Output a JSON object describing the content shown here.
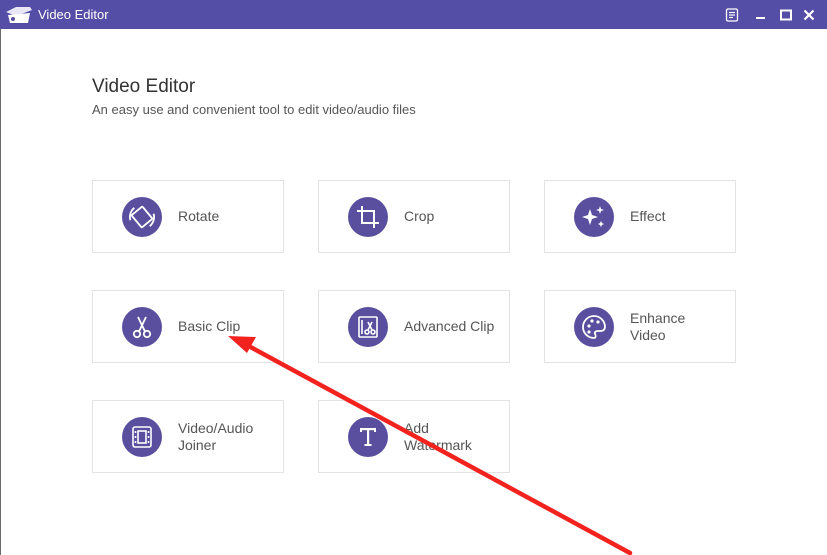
{
  "window": {
    "title": "Video Editor",
    "accent": "#554ea6"
  },
  "header": {
    "title": "Video Editor",
    "subtitle": "An easy use and convenient tool to edit video/audio files"
  },
  "tools": [
    {
      "label": "Rotate",
      "icon": "rotate-icon"
    },
    {
      "label": "Crop",
      "icon": "crop-icon"
    },
    {
      "label": "Effect",
      "icon": "sparkle-icon"
    },
    {
      "label": "Basic Clip",
      "icon": "scissors-icon"
    },
    {
      "label": "Advanced Clip",
      "icon": "film-scissors-icon"
    },
    {
      "label": "Enhance\nVideo",
      "icon": "palette-icon"
    },
    {
      "label": "Video/Audio\nJoiner",
      "icon": "film-joiner-icon"
    },
    {
      "label": "Add\nWatermark",
      "icon": "text-t-icon"
    }
  ],
  "icon_color": "#5a4f9e",
  "annotation": {
    "color": "#f2231f",
    "points_to": "Basic Clip"
  }
}
